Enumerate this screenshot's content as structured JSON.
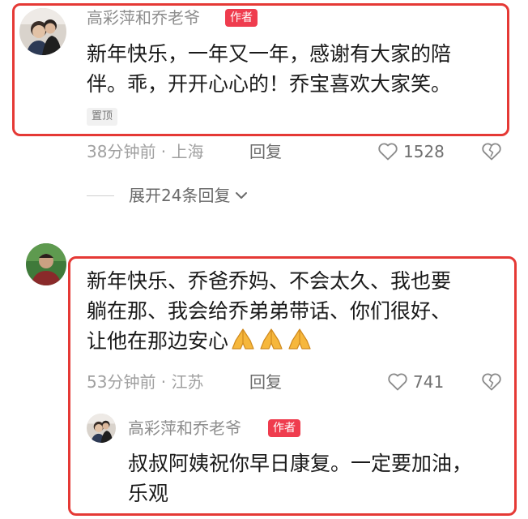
{
  "comment1": {
    "username": "高彩萍和乔老爷",
    "badge": "作者",
    "text_line1": "新年快乐，一年又一年，感谢有大家的陪",
    "text_line2": "伴。乖，开开心心的！乔宝喜欢大家笑。",
    "pin_label": "置顶",
    "meta": "38分钟前 · 上海",
    "reply_label": "回复",
    "like_count": "1528",
    "expand_label": "展开24条回复"
  },
  "comment2": {
    "text_line1": "新年快乐、乔爸乔妈、不会太久、我也要",
    "text_line2": "躺在那、我会给乔弟弟带话、你们很好、",
    "text_line3": "让他在那边安心",
    "emoji": "folded-hands",
    "meta": "53分钟前 · 江苏",
    "reply_label": "回复",
    "like_count": "741"
  },
  "reply1": {
    "username": "高彩萍和乔老爷",
    "badge": "作者",
    "text_line1": "叔叔阿姨祝你早日康复。一定要加油，",
    "text_line2": "乐观"
  },
  "colors": {
    "highlight": "#e53935",
    "badge_bg": "#ef3c4e",
    "text": "#1a1a1a",
    "muted": "#a0a0a0"
  }
}
